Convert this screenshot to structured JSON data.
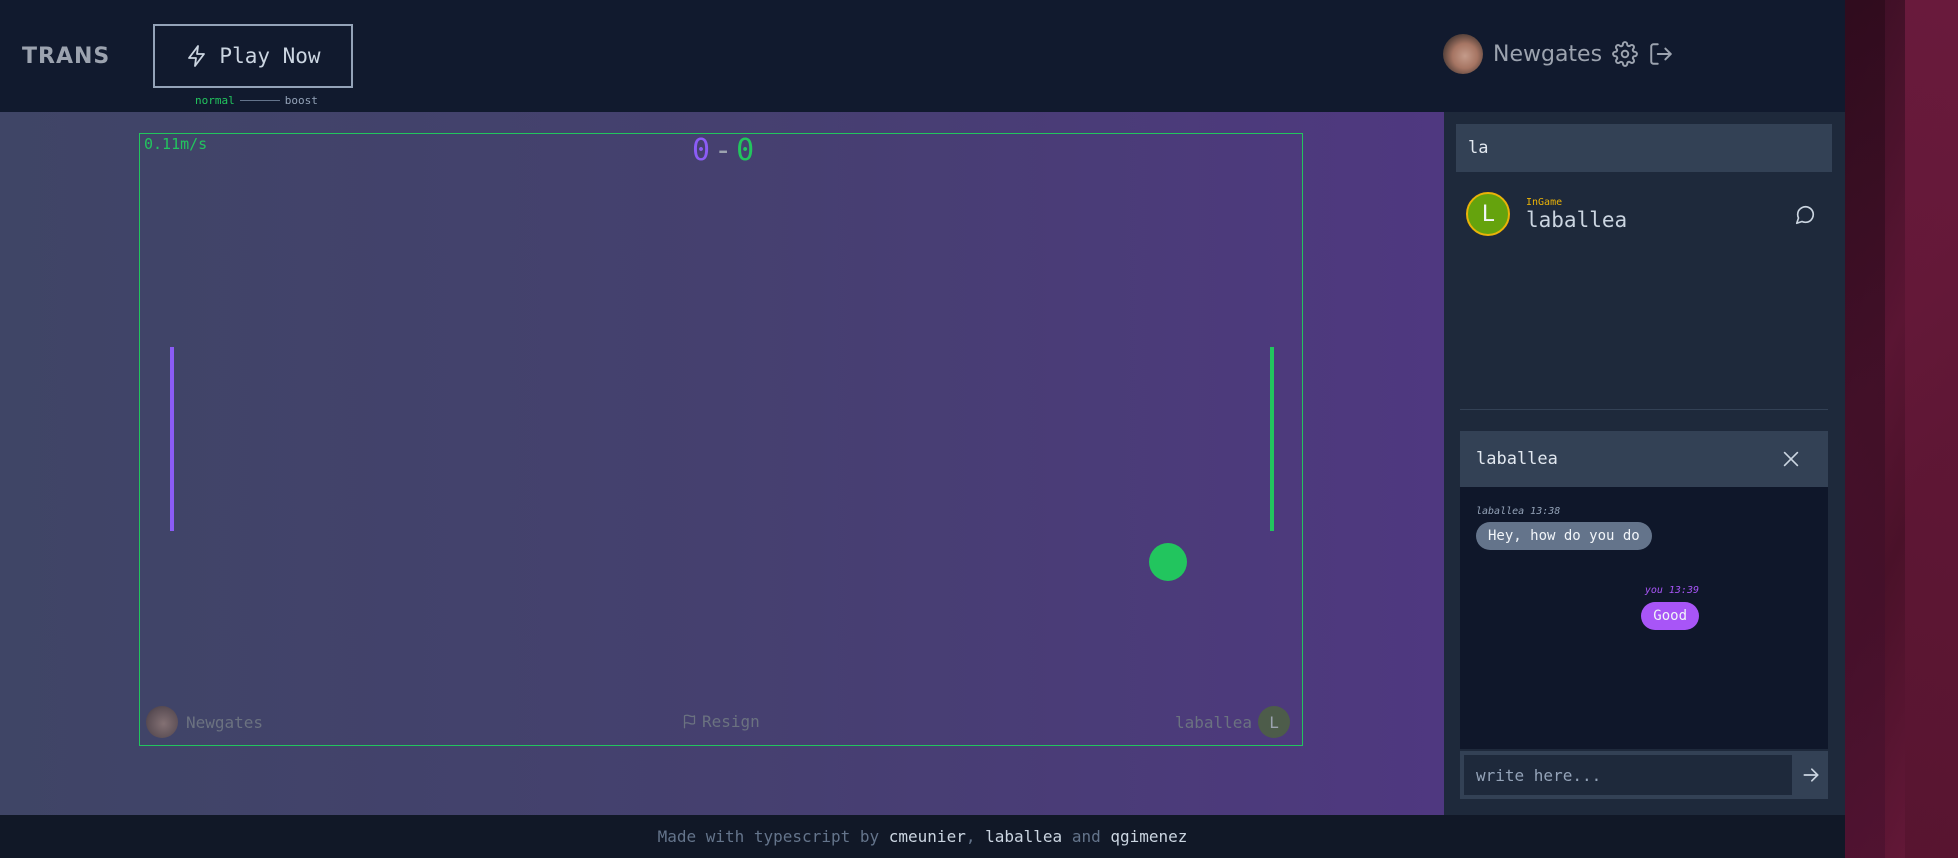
{
  "header": {
    "logo": "TRANS",
    "play_label": "Play Now",
    "mode_normal": "normal",
    "mode_boost": "boost",
    "username": "Newgates"
  },
  "game": {
    "speed": "0.11m/s",
    "score_left": "0",
    "score_sep": "-",
    "score_right": "0",
    "player_left": "Newgates",
    "resign_label": "Resign",
    "player_right": "laballea",
    "player_right_initial": "L"
  },
  "sidebar": {
    "search_value": "la",
    "friend": {
      "initial": "L",
      "status": "InGame",
      "name": "laballea"
    }
  },
  "chat": {
    "title": "laballea",
    "messages": [
      {
        "meta": "laballea 13:38",
        "text": "Hey, how do you do"
      },
      {
        "meta": "you 13:39",
        "text": "Good"
      }
    ],
    "input_placeholder": "write here..."
  },
  "footer": {
    "prefix": "Made with typescript by",
    "author1": "cmeunier",
    "sep1": ",",
    "author2": "laballea",
    "and": "and",
    "author3": "qgimenez"
  },
  "colors": {
    "accent_purple": "#8b5cf6",
    "accent_green": "#22c55e",
    "status_ingame": "#eab308",
    "bubble_self": "#a855f7"
  },
  "icons": [
    "bolt-icon",
    "gear-icon",
    "logout-icon",
    "flag-icon",
    "chat-bubble-icon",
    "close-icon",
    "arrow-right-icon"
  ]
}
